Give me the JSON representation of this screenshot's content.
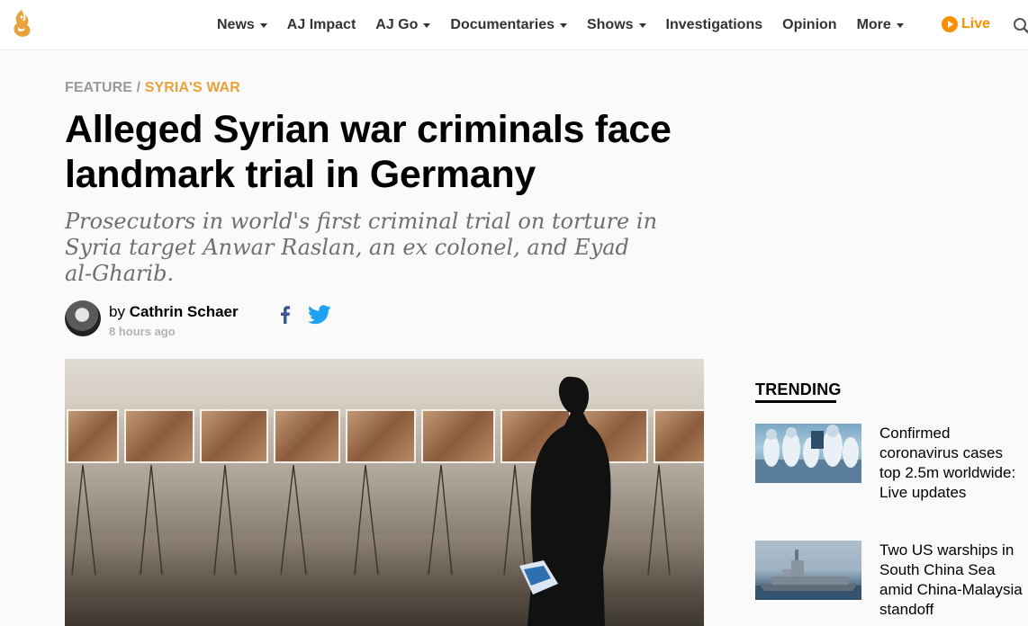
{
  "nav": {
    "items": [
      {
        "label": "News",
        "has_dropdown": true
      },
      {
        "label": "AJ Impact",
        "has_dropdown": false
      },
      {
        "label": "AJ Go",
        "has_dropdown": true
      },
      {
        "label": "Documentaries",
        "has_dropdown": true
      },
      {
        "label": "Shows",
        "has_dropdown": true
      },
      {
        "label": "Investigations",
        "has_dropdown": false
      },
      {
        "label": "Opinion",
        "has_dropdown": false
      },
      {
        "label": "More",
        "has_dropdown": true
      }
    ],
    "live_label": "Live",
    "logo_icon": "al-jazeera-logo-icon",
    "search_icon": "search-icon"
  },
  "article": {
    "breadcrumb": {
      "section": "FEATURE",
      "separator": "/",
      "topic": "SYRIA'S WAR"
    },
    "headline": "Alleged Syrian war criminals face landmark trial in Germany",
    "subheadline": "Prosecutors in world's first criminal trial on torture in Syria target Anwar Raslan, an ex colonel, and Eyad al-Gharib.",
    "byline": {
      "prefix": "by",
      "author": "Cathrin Schaer",
      "timestamp": "8 hours ago"
    },
    "share_icons": [
      "facebook-icon",
      "twitter-icon"
    ]
  },
  "trending": {
    "title": "TRENDING",
    "items": [
      {
        "headline": "Confirmed coronavirus cases top 2.5m worldwide: Live updates"
      },
      {
        "headline": "Two US warships in South China Sea amid China-Malaysia standoff"
      }
    ]
  },
  "colors": {
    "accent": "#fa9000",
    "topic": "#e8a23a",
    "muted": "#999999",
    "facebook": "#3b5998",
    "twitter": "#1da1f2"
  }
}
